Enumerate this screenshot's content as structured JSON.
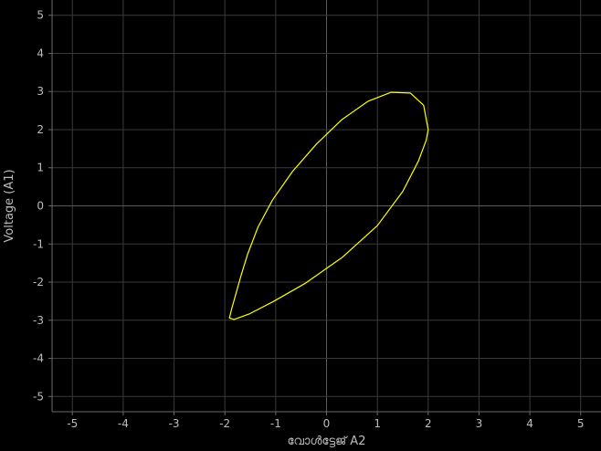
{
  "chart_data": {
    "type": "line",
    "title": "",
    "xlabel": "വോൾട്ടേജ് A2",
    "ylabel": "Voltage (A1)",
    "xlim": [
      -5.4,
      5.4
    ],
    "ylim": [
      -5.4,
      5.4
    ],
    "xticks": [
      -5,
      -4,
      -3,
      -2,
      -1,
      0,
      1,
      2,
      3,
      4,
      5
    ],
    "yticks": [
      -5,
      -4,
      -3,
      -2,
      -1,
      0,
      1,
      2,
      3,
      4,
      5
    ],
    "grid": true,
    "series": [
      {
        "color": "#ffff00",
        "x": [
          2,
          1.91,
          1.65,
          1.27,
          0.81,
          0.3,
          -0.2,
          -0.67,
          -1.06,
          -1.35,
          -1.55,
          -1.69,
          -1.79,
          -1.87,
          -1.91,
          -1.82,
          -1.53,
          -1.06,
          -0.43,
          0.3,
          1.0,
          1.5,
          1.81,
          1.96,
          2
        ],
        "y": [
          2.0,
          2.64,
          2.96,
          2.98,
          2.74,
          2.26,
          1.62,
          0.9,
          0.16,
          -0.56,
          -1.26,
          -1.86,
          -2.34,
          -2.72,
          -2.94,
          -2.98,
          -2.84,
          -2.52,
          -2.04,
          -1.36,
          -0.52,
          0.38,
          1.18,
          1.72,
          2.0
        ]
      }
    ]
  }
}
